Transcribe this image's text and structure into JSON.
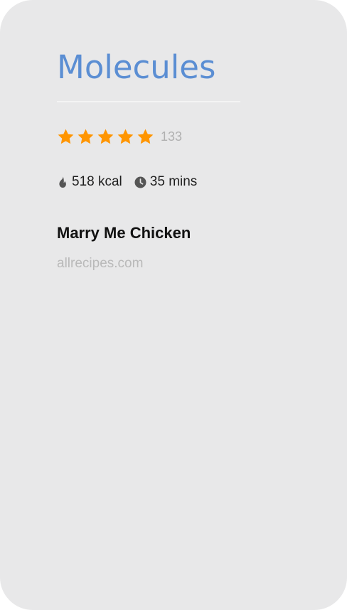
{
  "brand": {
    "name": "Molecules",
    "color": "#5b8ed3"
  },
  "recipe": {
    "rating": {
      "stars": 5,
      "max_stars": 5,
      "count": "133",
      "star_color": "#ff9500",
      "icon": "star-icon"
    },
    "calories": {
      "icon": "flame-icon",
      "value": "518 kcal"
    },
    "time": {
      "icon": "clock-icon",
      "value": "35 mins"
    },
    "title": "Marry Me Chicken",
    "source": "allrecipes.com"
  },
  "colors": {
    "card_background": "#e8e8e9",
    "text_primary": "#111111",
    "text_muted": "#b9b9b9"
  }
}
